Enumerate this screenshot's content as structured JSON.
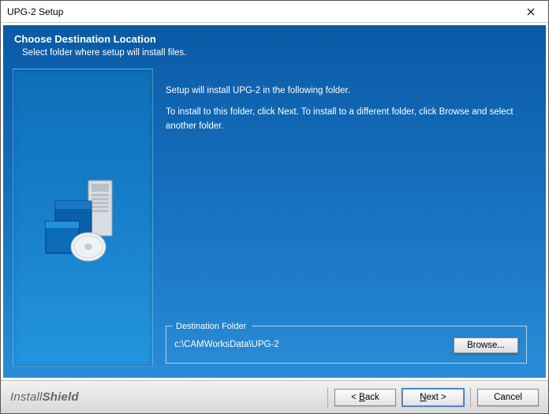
{
  "window": {
    "title": "UPG-2 Setup"
  },
  "header": {
    "title": "Choose Destination Location",
    "subtitle": "Select folder where setup will install files."
  },
  "body": {
    "line1": "Setup will install UPG-2 in the following folder.",
    "line2": "To install to this folder, click Next. To install to a different folder, click Browse and select another folder."
  },
  "destination": {
    "legend": "Destination Folder",
    "path": "c:\\CAMWorksData\\UPG-2",
    "browse_label": "Browse..."
  },
  "footer": {
    "brand_light": "Install",
    "brand_bold": "Shield",
    "back_prefix": "< ",
    "back_key": "B",
    "back_rest": "ack",
    "next_key": "N",
    "next_rest": "ext >",
    "cancel_label": "Cancel"
  }
}
